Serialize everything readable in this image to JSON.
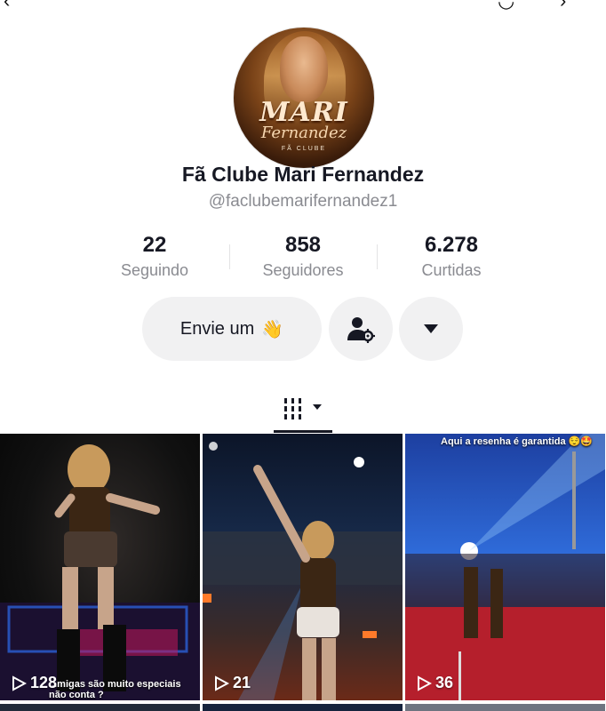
{
  "profile": {
    "display_name": "Fã Clube Mari Fernandez",
    "username": "@faclubemarifernandez1",
    "avatar_brand": "MARI",
    "avatar_brand_sub": "Fernandez",
    "avatar_brand_small": "FÃ CLUBE"
  },
  "stats": [
    {
      "value": "22",
      "label": "Seguindo"
    },
    {
      "value": "858",
      "label": "Seguidores"
    },
    {
      "value": "6.278",
      "label": "Curtidas"
    }
  ],
  "actions": {
    "message_label": "Envie um",
    "message_emoji": "👋"
  },
  "videos": [
    {
      "views": "128",
      "caption": "...migas são muito especiais não conta ?"
    },
    {
      "views": "21",
      "caption": ""
    },
    {
      "views": "36",
      "caption": "Aqui a resenha é garantida 😌🤩"
    }
  ],
  "colors": {
    "text_primary": "#161823",
    "text_secondary": "#8a8b91",
    "button_bg": "#f1f1f2"
  }
}
